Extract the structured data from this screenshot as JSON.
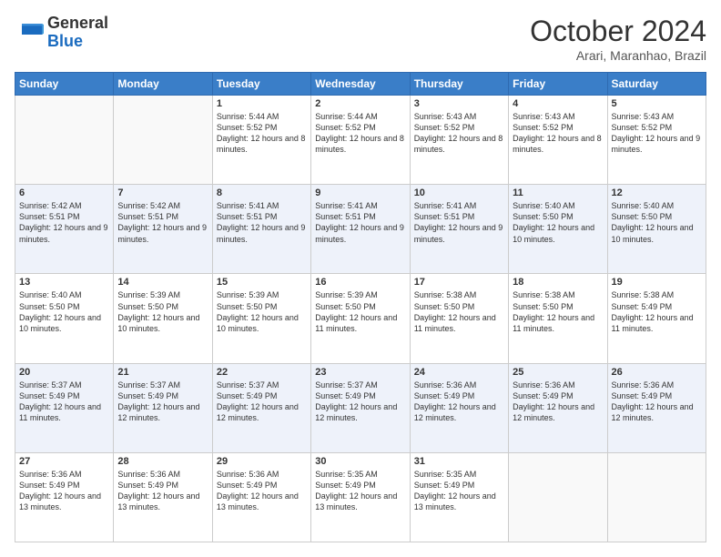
{
  "header": {
    "logo_general": "General",
    "logo_blue": "Blue",
    "month_title": "October 2024",
    "subtitle": "Arari, Maranhao, Brazil"
  },
  "days_of_week": [
    "Sunday",
    "Monday",
    "Tuesday",
    "Wednesday",
    "Thursday",
    "Friday",
    "Saturday"
  ],
  "weeks": [
    [
      {
        "day": "",
        "empty": true
      },
      {
        "day": "",
        "empty": true
      },
      {
        "day": "1",
        "sunrise": "5:44 AM",
        "sunset": "5:52 PM",
        "daylight": "12 hours and 8 minutes."
      },
      {
        "day": "2",
        "sunrise": "5:44 AM",
        "sunset": "5:52 PM",
        "daylight": "12 hours and 8 minutes."
      },
      {
        "day": "3",
        "sunrise": "5:43 AM",
        "sunset": "5:52 PM",
        "daylight": "12 hours and 8 minutes."
      },
      {
        "day": "4",
        "sunrise": "5:43 AM",
        "sunset": "5:52 PM",
        "daylight": "12 hours and 8 minutes."
      },
      {
        "day": "5",
        "sunrise": "5:43 AM",
        "sunset": "5:52 PM",
        "daylight": "12 hours and 9 minutes."
      }
    ],
    [
      {
        "day": "6",
        "sunrise": "5:42 AM",
        "sunset": "5:51 PM",
        "daylight": "12 hours and 9 minutes."
      },
      {
        "day": "7",
        "sunrise": "5:42 AM",
        "sunset": "5:51 PM",
        "daylight": "12 hours and 9 minutes."
      },
      {
        "day": "8",
        "sunrise": "5:41 AM",
        "sunset": "5:51 PM",
        "daylight": "12 hours and 9 minutes."
      },
      {
        "day": "9",
        "sunrise": "5:41 AM",
        "sunset": "5:51 PM",
        "daylight": "12 hours and 9 minutes."
      },
      {
        "day": "10",
        "sunrise": "5:41 AM",
        "sunset": "5:51 PM",
        "daylight": "12 hours and 9 minutes."
      },
      {
        "day": "11",
        "sunrise": "5:40 AM",
        "sunset": "5:50 PM",
        "daylight": "12 hours and 10 minutes."
      },
      {
        "day": "12",
        "sunrise": "5:40 AM",
        "sunset": "5:50 PM",
        "daylight": "12 hours and 10 minutes."
      }
    ],
    [
      {
        "day": "13",
        "sunrise": "5:40 AM",
        "sunset": "5:50 PM",
        "daylight": "12 hours and 10 minutes."
      },
      {
        "day": "14",
        "sunrise": "5:39 AM",
        "sunset": "5:50 PM",
        "daylight": "12 hours and 10 minutes."
      },
      {
        "day": "15",
        "sunrise": "5:39 AM",
        "sunset": "5:50 PM",
        "daylight": "12 hours and 10 minutes."
      },
      {
        "day": "16",
        "sunrise": "5:39 AM",
        "sunset": "5:50 PM",
        "daylight": "12 hours and 11 minutes."
      },
      {
        "day": "17",
        "sunrise": "5:38 AM",
        "sunset": "5:50 PM",
        "daylight": "12 hours and 11 minutes."
      },
      {
        "day": "18",
        "sunrise": "5:38 AM",
        "sunset": "5:50 PM",
        "daylight": "12 hours and 11 minutes."
      },
      {
        "day": "19",
        "sunrise": "5:38 AM",
        "sunset": "5:49 PM",
        "daylight": "12 hours and 11 minutes."
      }
    ],
    [
      {
        "day": "20",
        "sunrise": "5:37 AM",
        "sunset": "5:49 PM",
        "daylight": "12 hours and 11 minutes."
      },
      {
        "day": "21",
        "sunrise": "5:37 AM",
        "sunset": "5:49 PM",
        "daylight": "12 hours and 12 minutes."
      },
      {
        "day": "22",
        "sunrise": "5:37 AM",
        "sunset": "5:49 PM",
        "daylight": "12 hours and 12 minutes."
      },
      {
        "day": "23",
        "sunrise": "5:37 AM",
        "sunset": "5:49 PM",
        "daylight": "12 hours and 12 minutes."
      },
      {
        "day": "24",
        "sunrise": "5:36 AM",
        "sunset": "5:49 PM",
        "daylight": "12 hours and 12 minutes."
      },
      {
        "day": "25",
        "sunrise": "5:36 AM",
        "sunset": "5:49 PM",
        "daylight": "12 hours and 12 minutes."
      },
      {
        "day": "26",
        "sunrise": "5:36 AM",
        "sunset": "5:49 PM",
        "daylight": "12 hours and 12 minutes."
      }
    ],
    [
      {
        "day": "27",
        "sunrise": "5:36 AM",
        "sunset": "5:49 PM",
        "daylight": "12 hours and 13 minutes."
      },
      {
        "day": "28",
        "sunrise": "5:36 AM",
        "sunset": "5:49 PM",
        "daylight": "12 hours and 13 minutes."
      },
      {
        "day": "29",
        "sunrise": "5:36 AM",
        "sunset": "5:49 PM",
        "daylight": "12 hours and 13 minutes."
      },
      {
        "day": "30",
        "sunrise": "5:35 AM",
        "sunset": "5:49 PM",
        "daylight": "12 hours and 13 minutes."
      },
      {
        "day": "31",
        "sunrise": "5:35 AM",
        "sunset": "5:49 PM",
        "daylight": "12 hours and 13 minutes."
      },
      {
        "day": "",
        "empty": true
      },
      {
        "day": "",
        "empty": true
      }
    ]
  ],
  "labels": {
    "sunrise": "Sunrise:",
    "sunset": "Sunset:",
    "daylight": "Daylight:"
  }
}
